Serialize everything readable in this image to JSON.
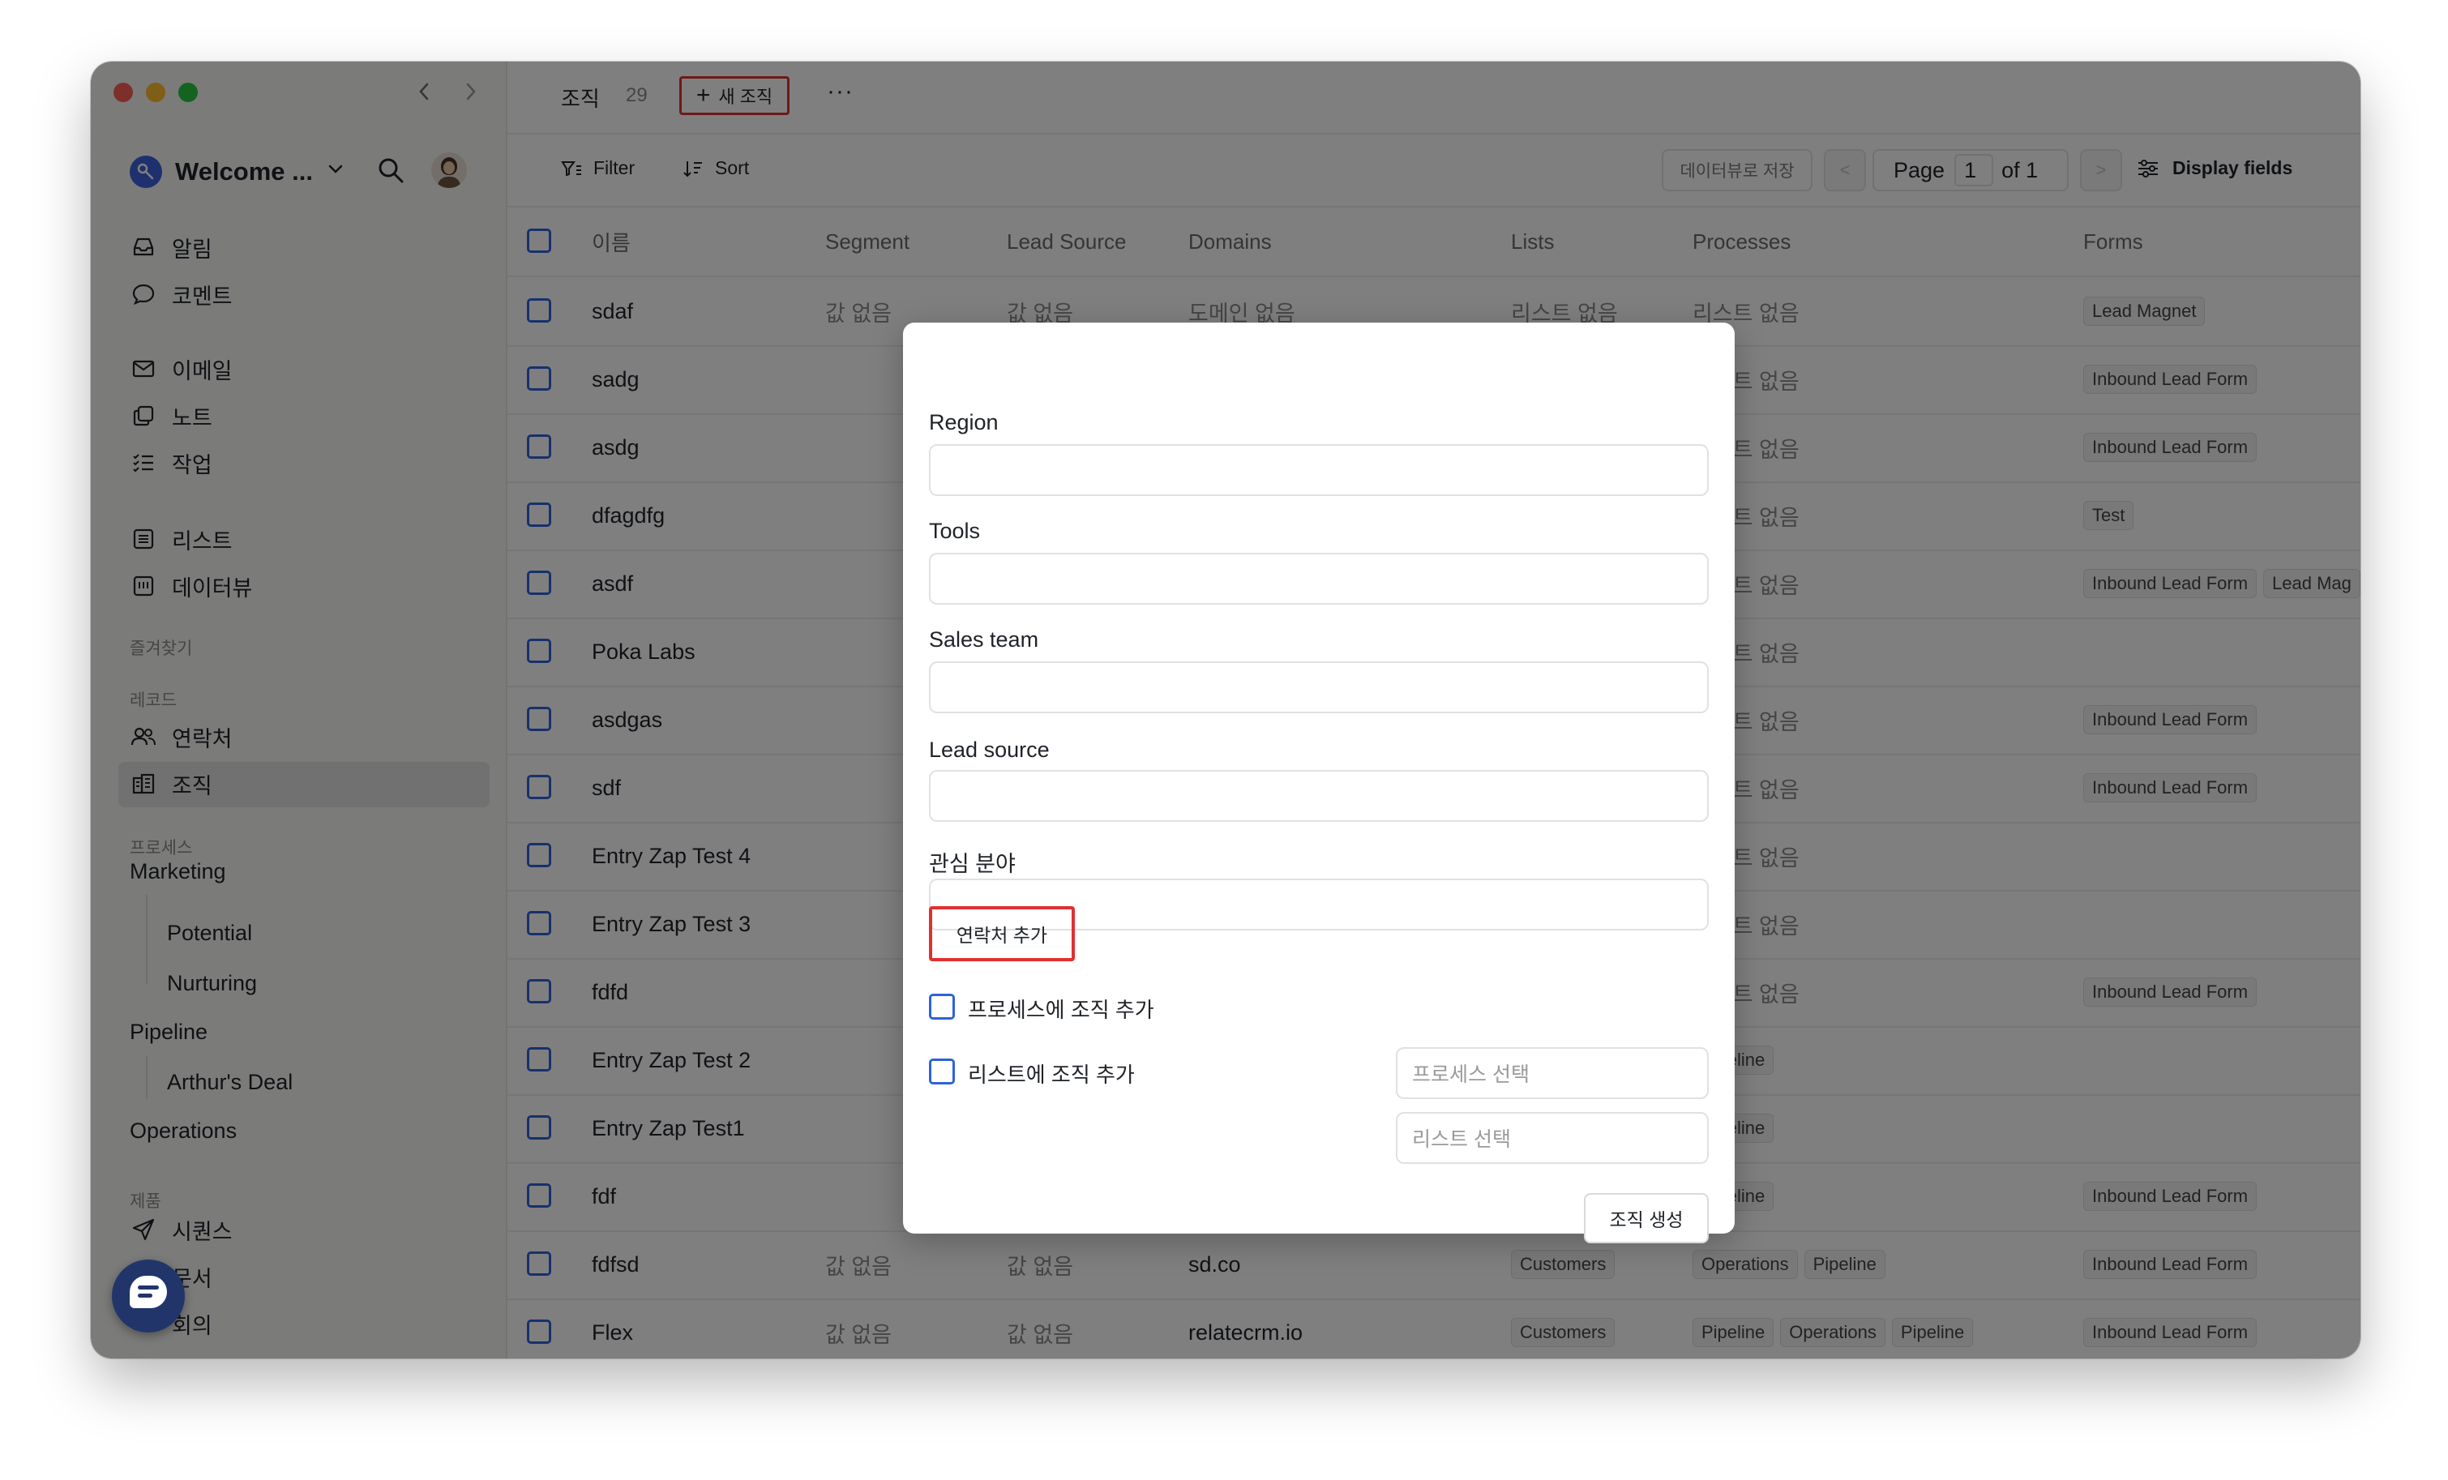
{
  "sidebar": {
    "workspace": "Welcome ...",
    "items_top": [
      {
        "label": "알림",
        "icon": "inbox-icon"
      },
      {
        "label": "코멘트",
        "icon": "comment-icon"
      }
    ],
    "items_mid": [
      {
        "label": "이메일",
        "icon": "mail-icon"
      },
      {
        "label": "노트",
        "icon": "note-icon"
      },
      {
        "label": "작업",
        "icon": "task-list-icon"
      }
    ],
    "items_lists": [
      {
        "label": "리스트",
        "icon": "list-icon"
      },
      {
        "label": "데이터뷰",
        "icon": "dataview-icon"
      }
    ],
    "favorites_label": "즐겨찾기",
    "records_label": "레코드",
    "records": [
      {
        "label": "연락처",
        "icon": "contacts-icon"
      },
      {
        "label": "조직",
        "icon": "building-icon"
      }
    ],
    "process_label": "프로세스",
    "processes": {
      "marketing": "Marketing",
      "potential": "Potential",
      "nurturing": "Nurturing",
      "pipeline": "Pipeline",
      "arthurs_deal": "Arthur's Deal",
      "operations": "Operations"
    },
    "products_label": "제품",
    "products": [
      {
        "label": "시퀀스",
        "icon": "send-icon"
      },
      {
        "label": "문서",
        "icon": "document-icon"
      },
      {
        "label": "회의",
        "icon": "meeting-icon"
      }
    ]
  },
  "topbar": {
    "title": "조직",
    "count": "29",
    "new_button": "새 조직",
    "more": "···"
  },
  "toolbar": {
    "filter": "Filter",
    "sort": "Sort",
    "save_view": "데이터뷰로 저장",
    "prev": "<",
    "next": ">",
    "page_label": "Page",
    "page_value": "1",
    "page_of": "of 1",
    "display_fields": "Display fields"
  },
  "table": {
    "headers": {
      "name": "이름",
      "segment": "Segment",
      "lead_source": "Lead Source",
      "domains": "Domains",
      "lists": "Lists",
      "processes": "Processes",
      "forms": "Forms"
    },
    "rows": [
      {
        "name": "sdaf",
        "segment": "값 없음",
        "lead_source": "값 없음",
        "domains": "도메인 없음",
        "lists": "리스트 없음",
        "processes_text": "리스트 없음",
        "process_tags": [],
        "form_tags": [
          "Lead Magnet"
        ]
      },
      {
        "name": "sadg",
        "segment": "",
        "lead_source": "",
        "domains": "",
        "lists": "",
        "processes_text": "리스트 없음",
        "process_tags": [],
        "form_tags": [
          "Inbound Lead Form"
        ]
      },
      {
        "name": "asdg",
        "segment": "",
        "lead_source": "",
        "domains": "",
        "lists": "",
        "processes_text": "리스트 없음",
        "process_tags": [],
        "form_tags": [
          "Inbound Lead Form"
        ]
      },
      {
        "name": "dfagdfg",
        "segment": "",
        "lead_source": "",
        "domains": "",
        "lists": "",
        "processes_text": "리스트 없음",
        "process_tags": [],
        "form_tags": [
          "Test"
        ]
      },
      {
        "name": "asdf",
        "segment": "",
        "lead_source": "",
        "domains": "",
        "lists": "",
        "processes_text": "리스트 없음",
        "process_tags": [],
        "form_tags": [
          "Inbound Lead Form",
          "Lead Mag"
        ]
      },
      {
        "name": "Poka Labs",
        "segment": "",
        "lead_source": "",
        "domains": "",
        "lists": "",
        "processes_text": "리스트 없음",
        "process_tags": [],
        "form_tags": []
      },
      {
        "name": "asdgas",
        "segment": "",
        "lead_source": "",
        "domains": "",
        "lists": "",
        "processes_text": "리스트 없음",
        "process_tags": [],
        "form_tags": [
          "Inbound Lead Form"
        ]
      },
      {
        "name": "sdf",
        "segment": "",
        "lead_source": "",
        "domains": "",
        "lists": "",
        "processes_text": "리스트 없음",
        "process_tags": [],
        "form_tags": [
          "Inbound Lead Form"
        ]
      },
      {
        "name": "Entry Zap Test 4",
        "segment": "",
        "lead_source": "",
        "domains": "",
        "lists": "",
        "processes_text": "리스트 없음",
        "process_tags": [],
        "form_tags": []
      },
      {
        "name": "Entry Zap Test 3",
        "segment": "",
        "lead_source": "",
        "domains": "",
        "lists": "",
        "processes_text": "리스트 없음",
        "process_tags": [],
        "form_tags": []
      },
      {
        "name": "fdfd",
        "segment": "",
        "lead_source": "",
        "domains": "",
        "lists": "",
        "processes_text": "리스트 없음",
        "process_tags": [],
        "form_tags": [
          "Inbound Lead Form"
        ]
      },
      {
        "name": "Entry Zap Test 2",
        "segment": "",
        "lead_source": "",
        "domains": "",
        "lists": "",
        "processes_text": "",
        "process_tags": [
          "Pipeline"
        ],
        "form_tags": []
      },
      {
        "name": "Entry Zap Test1",
        "segment": "",
        "lead_source": "",
        "domains": "",
        "lists": "",
        "processes_text": "",
        "process_tags": [
          "Pipeline"
        ],
        "form_tags": []
      },
      {
        "name": "fdf",
        "segment": "",
        "lead_source": "",
        "domains": "",
        "lists": "",
        "processes_text": "",
        "process_tags": [
          "Pipeline"
        ],
        "form_tags": [
          "Inbound Lead Form"
        ]
      },
      {
        "name": "fdfsd",
        "segment": "값 없음",
        "lead_source": "값 없음",
        "domains": "sd.co",
        "lists": "",
        "list_tags": [
          "Customers"
        ],
        "processes_text": "",
        "process_tags": [
          "Operations",
          "Pipeline"
        ],
        "form_tags": [
          "Inbound Lead Form"
        ]
      },
      {
        "name": "Flex",
        "segment": "값 없음",
        "lead_source": "값 없음",
        "domains": "relatecrm.io",
        "lists": "",
        "list_tags": [
          "Customers"
        ],
        "processes_text": "",
        "process_tags": [
          "Pipeline",
          "Operations",
          "Pipeline"
        ],
        "form_tags": [
          "Inbound Lead Form"
        ]
      }
    ]
  },
  "modal": {
    "region_label": "Region",
    "tools_label": "Tools",
    "sales_team_label": "Sales team",
    "lead_source_label": "Lead source",
    "interest_label": "관심 분야",
    "add_contact": "연락처 추가",
    "add_to_process": "프로세스에 조직 추가",
    "process_placeholder": "프로세스 선택",
    "add_to_list": "리스트에 조직 추가",
    "list_placeholder": "리스트 선택",
    "submit": "조직 생성"
  },
  "colors": {
    "accent": "#2f62d9",
    "highlight": "#e03131",
    "overlay": "rgba(0,0,0,0.5)"
  }
}
